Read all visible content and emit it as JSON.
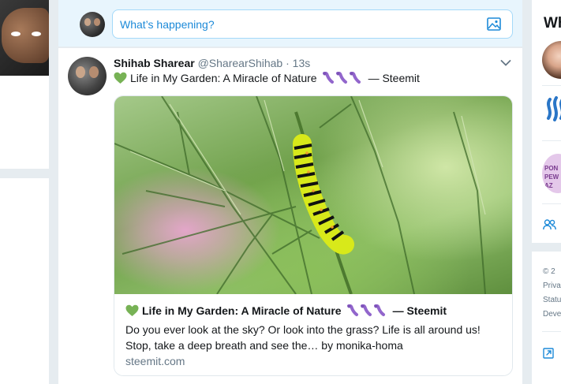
{
  "compose": {
    "placeholder": "What’s happening?",
    "media_icon": "image-icon"
  },
  "tweet": {
    "author_name": "Shihab Sharear",
    "author_handle": "@SharearShihab",
    "separator": "·",
    "time": "13s",
    "text_emoji": "green-heart",
    "text": "Life in My Garden: A Miracle of Nature",
    "text_suffix": "— Steemit",
    "caterpillar_emoji_count": 3,
    "menu_icon": "chevron-down-icon",
    "card": {
      "image_alt": "caterpillar on fennel",
      "title": "Life in My Garden: A Miracle of Nature",
      "title_suffix": "— Steemit",
      "description": "Do you ever look at the sky? Or look into the grass? Life is all around us! Stop, take a deep breath and see the… by monika-homa",
      "domain": "steemit.com"
    }
  },
  "right_panel": {
    "title_partial": "Wh",
    "footer_lines": [
      "© 2",
      "Priva",
      "Statu",
      "Deve"
    ]
  },
  "colors": {
    "background": "#e6ecf0",
    "compose_bg": "#e8f5fd",
    "link_blue": "#1d8ad8",
    "muted": "#657786",
    "heart_green": "#77b255",
    "caterpillar_purple": "#9266cc"
  }
}
